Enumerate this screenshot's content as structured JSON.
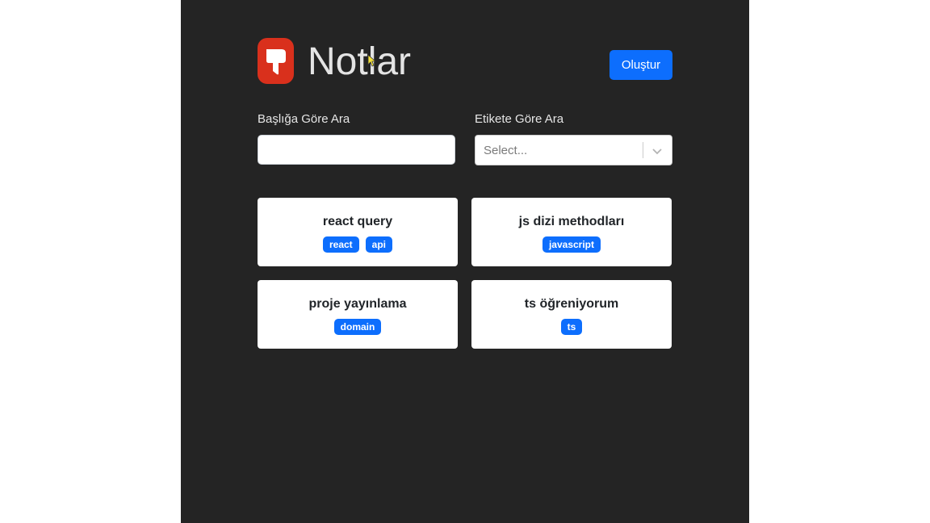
{
  "header": {
    "title": "Notlar",
    "logo_icon": "note-logo-icon",
    "create_label": "Oluştur"
  },
  "filters": {
    "title_search_label": "Başlığa Göre Ara",
    "title_search_value": "",
    "tag_search_label": "Etikete Göre Ara",
    "tag_search_placeholder": "Select..."
  },
  "notes": [
    {
      "title": "react query",
      "tags": [
        "react",
        "api"
      ]
    },
    {
      "title": "js dizi methodları",
      "tags": [
        "javascript"
      ]
    },
    {
      "title": "proje yayınlama",
      "tags": [
        "domain"
      ]
    },
    {
      "title": "ts öğreniyorum",
      "tags": [
        "ts"
      ]
    }
  ],
  "colors": {
    "background": "#242424",
    "accent": "#0d6efd",
    "logo": "#d9301c",
    "card": "#ffffff"
  }
}
